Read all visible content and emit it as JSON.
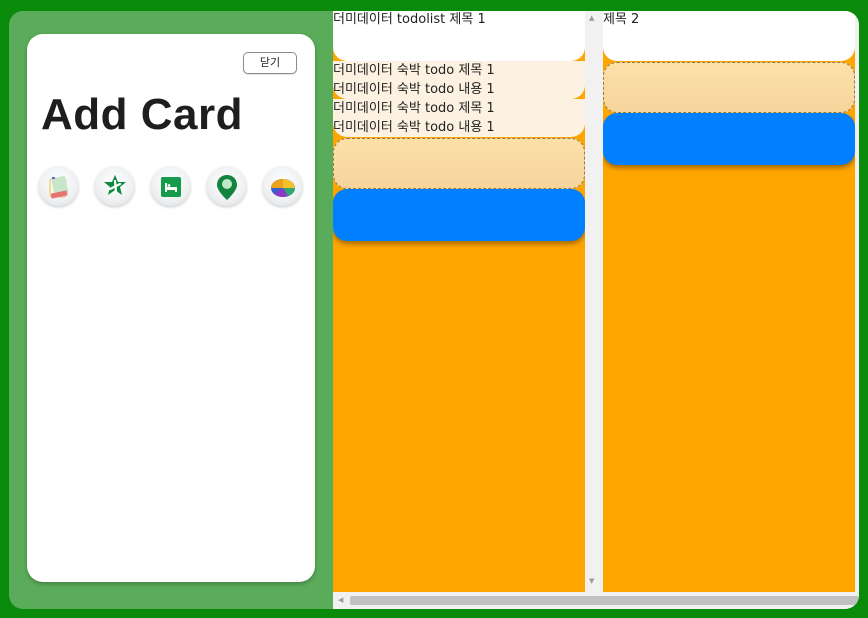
{
  "add_card": {
    "close_label": "닫기",
    "title": "Add Card",
    "icons": [
      "notepad-icon",
      "airplane-icon",
      "hotel-bed-icon",
      "map-pin-icon",
      "pie-chart-icon"
    ]
  },
  "board": {
    "columns": [
      {
        "title": "더미데이터 todolist 제목 1",
        "items": [
          {
            "title": "더미데이터 숙박 todo 제목 1",
            "content": "더미데이터 숙박 todo 내용 1"
          },
          {
            "title": "더미데이터 숙박 todo 제목 1",
            "content": "더미데이터 숙박 todo 내용 1"
          }
        ]
      },
      {
        "title": "제목 2",
        "items": []
      }
    ]
  },
  "colors": {
    "background": "#0a8a0a",
    "panel": "#5aac5a",
    "column": "#ffa500",
    "add_button": "#0080ff",
    "placeholder": "#f8d89e"
  }
}
